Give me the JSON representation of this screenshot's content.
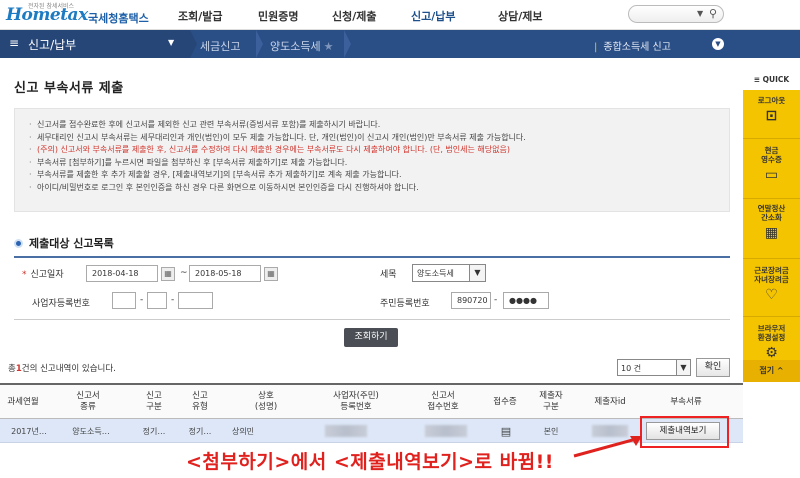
{
  "header": {
    "logo_text": "Hometax",
    "logo_small": "전자된 참세서비스",
    "logo_korean": "국세청홈택스",
    "nav": [
      "조회/발급",
      "민원증명",
      "신청/제출",
      "신고/납부",
      "상담/제보"
    ],
    "active_nav": "신고/납부"
  },
  "menubar": {
    "menu_label": "신고/납부",
    "crumbs": [
      "세금신고",
      "양도소득세"
    ],
    "notice": "종합소득세 신고"
  },
  "page": {
    "title": "신고 부속서류 제출"
  },
  "info": [
    {
      "text": "신고서를 접수완료한 후에 신고서를 제외한 신고 관련 부속서류(증빙서류 포함)를 제출하시기 바랍니다.",
      "red": false
    },
    {
      "text": "세무대리인 신고시 부속서류는 세무대리인과 개인(법인)이 모두 제출 가능합니다. 단, 개인(법인)이 신고시 개인(법인)만 부속서류 제출 가능합니다.",
      "red": false
    },
    {
      "text": "(주의) 신고서와 부속서류를 제출한 후, 신고서를 수정하여 다시 제출한 경우에는 부속서류도 다시 제출하여야 합니다. (단, 법인세는 해당없음)",
      "red": true
    },
    {
      "text": "부속서류 [첨부하기]를 누르시면 파일을 첨부하신 후 [부속서류 제출하기]로 제출 가능합니다.",
      "red": false
    },
    {
      "text": "부속서류를 제출한 후 추가 제출할 경우, [제출내역보기]의 [부속서류 추가 제출하기]로 계속 제출 가능합니다.",
      "red": false
    },
    {
      "text": "아이디/비밀번호로 로그인 후 본인인증을 하신 경우 다른 화면으로 이동하시면 본인인증을 다시 진행하셔야 합니다.",
      "red": false
    }
  ],
  "section": {
    "title": "제출대상 신고목록"
  },
  "form": {
    "date_label": "신고일자",
    "date_from": "2018-04-18",
    "date_to": "2018-05-18",
    "tax_label": "세목",
    "tax_value": "양도소득세",
    "bizno_label": "사업자등록번호",
    "rrn_label": "주민등록번호",
    "rrn_front": "890720",
    "rrn_back": "●●●●",
    "query_button": "조회하기"
  },
  "results": {
    "count_prefix": "총",
    "count_num": "1",
    "count_suffix": "건의 신고내역이 있습니다.",
    "page_size": "10 건",
    "ok_button": "확인"
  },
  "table": {
    "headers": [
      "과세연월",
      "신고서\n종류",
      "신고\n구분",
      "신고\n유형",
      "상호\n(성명)",
      "사업자(주민)\n등록번호",
      "신고서\n접수번호",
      "접수증",
      "제출자\n구분",
      "제출자id",
      "부속서류"
    ],
    "row": {
      "period": "2017년…",
      "form_type": "양도소득…",
      "category": "정기…",
      "filing_type": "정기…",
      "name": "상의민",
      "submitter_type": "본인",
      "view_button": "제출내역보기"
    }
  },
  "annotation": "<첨부하기>에서 <제출내역보기>로 바뀜!!",
  "quick": {
    "head": "≡ QUICK",
    "items": [
      {
        "label": "로그아웃",
        "icon": "🔓"
      },
      {
        "label": "현금\n영수증",
        "icon": "🧾"
      },
      {
        "label": "연말정산\n간소화",
        "icon": "▦"
      },
      {
        "label": "근로장려금\n자녀장려금",
        "icon": "♡"
      },
      {
        "label": "브라우저\n환경설정",
        "icon": "⚙"
      }
    ],
    "bottom": "접기 ^"
  }
}
